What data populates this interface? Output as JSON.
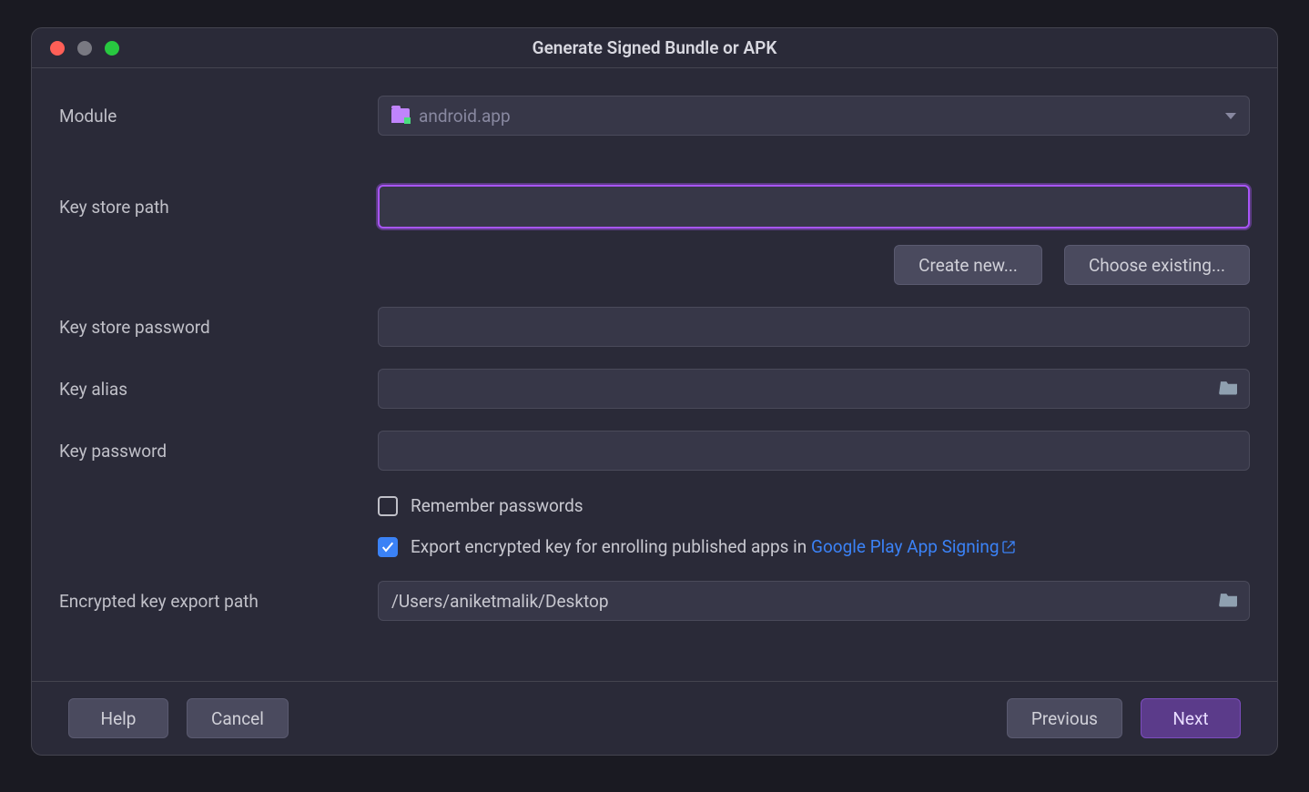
{
  "title": "Generate Signed Bundle or APK",
  "labels": {
    "module": "Module",
    "keystore_path": "Key store path",
    "keystore_password": "Key store password",
    "key_alias": "Key alias",
    "key_password": "Key password",
    "encrypted_export_path": "Encrypted key export path"
  },
  "module": {
    "value": "android.app"
  },
  "keystore_path_value": "",
  "keystore_password_value": "",
  "key_alias_value": "",
  "key_password_value": "",
  "buttons": {
    "create_new": "Create new...",
    "choose_existing": "Choose existing...",
    "help": "Help",
    "cancel": "Cancel",
    "previous": "Previous",
    "next": "Next"
  },
  "checkboxes": {
    "remember_passwords": {
      "label": "Remember passwords",
      "checked": false
    },
    "export_encrypted": {
      "prefix": "Export encrypted key for enrolling published apps in ",
      "link_text": "Google Play App Signing",
      "checked": true
    }
  },
  "encrypted_export_path_value": "/Users/aniketmalik/Desktop"
}
